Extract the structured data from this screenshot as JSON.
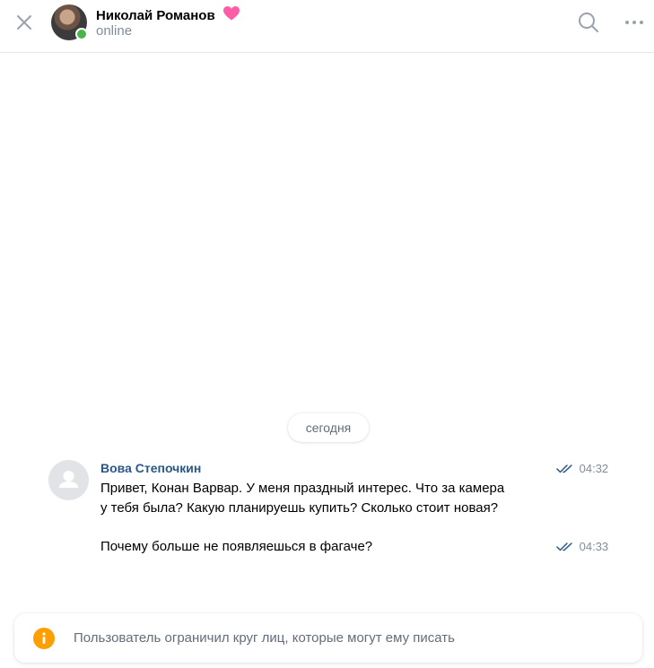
{
  "header": {
    "peer_name": "Николай Романов",
    "peer_status": "online",
    "icons": {
      "close": "close-icon",
      "status_emoji": "heart-icon",
      "search": "search-icon",
      "more": "more-icon"
    }
  },
  "chat": {
    "date_label": "сегодня",
    "messages": [
      {
        "sender": "Вова Степочкин",
        "text_lines": [
          "Привет, Конан Варвар. У меня праздный интерес. Что за камера",
          "у тебя была? Какую планируешь купить? Сколько стоит новая?"
        ],
        "time": "04:32",
        "read": true
      },
      {
        "text_lines": [
          "Почему больше не появляешься в фагаче?"
        ],
        "time": "04:33",
        "read": true
      }
    ]
  },
  "notice": {
    "icon": "info-icon",
    "text": "Пользователь ограничил круг лиц, которые могут ему писать"
  },
  "colors": {
    "accent_link": "#2a5885",
    "secondary_text": "#818c99",
    "online": "#4bb34b",
    "read_check": "#2a5885",
    "warning": "#ff9e00",
    "heart": "#ff5ca8"
  }
}
